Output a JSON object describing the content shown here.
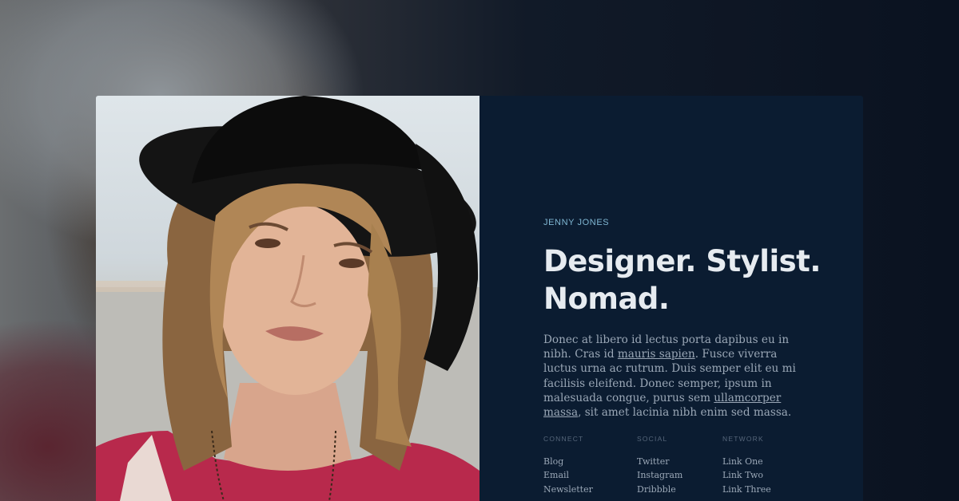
{
  "profile": {
    "name": "JENNY JONES",
    "headline": "Designer. Stylist. Nomad.",
    "bio": {
      "p1": "Donec at libero id lectus porta dapibus eu in nibh. Cras id ",
      "link1": "mauris sapien",
      "p2": ". Fusce viverra luctus urna ac rutrum. Duis semper elit eu mi facilisis eleifend. Donec semper, ipsum in malesuada congue, purus sem ",
      "link2": "ullamcorper massa",
      "p3": ", sit amet lacinia nibh enim sed massa."
    }
  },
  "columns": [
    {
      "title": "CONNECT",
      "links": [
        "Blog",
        "Email",
        "Newsletter"
      ]
    },
    {
      "title": "SOCIAL",
      "links": [
        "Twitter",
        "Instagram",
        "Dribbble"
      ]
    },
    {
      "title": "NETWORK",
      "links": [
        "Link One",
        "Link Two",
        "Link Three"
      ]
    }
  ],
  "colors": {
    "panel_bg": "#0b1c31",
    "accent": "#7fb6d2",
    "headline": "#e6ebf0",
    "body_text": "#9aa7b6"
  }
}
